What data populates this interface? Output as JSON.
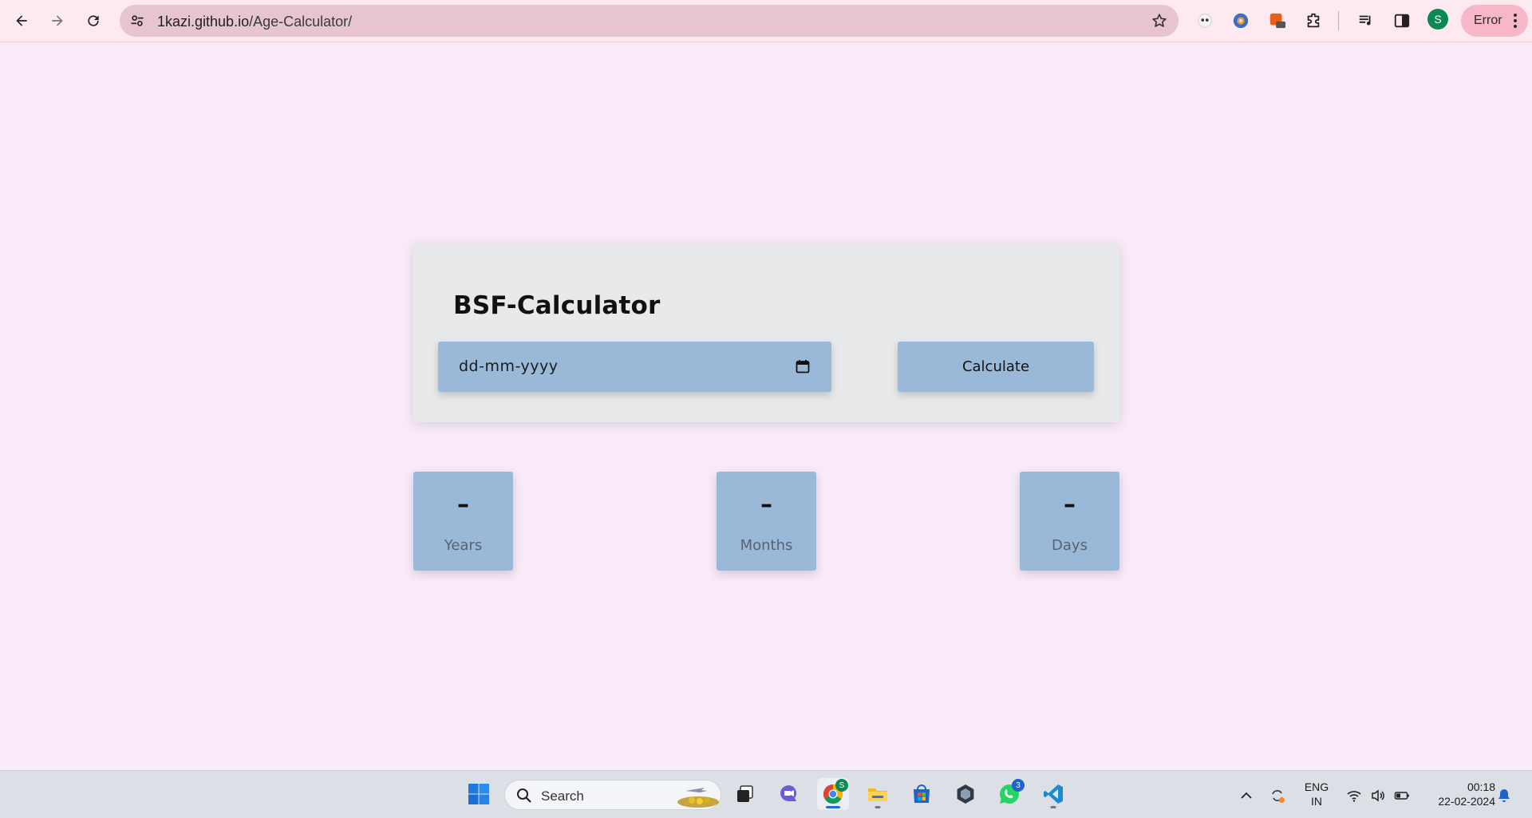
{
  "browser": {
    "url_host": "1kazi.github.io",
    "url_path": "/Age-Calculator/",
    "profile_initial": "S",
    "error_label": "Error",
    "extensions": [
      "panda-extension-icon",
      "ublock-icon",
      "off-extension-icon",
      "puzzle-extensions-icon"
    ],
    "ext_badge": "off"
  },
  "calculator": {
    "title": "BSF-Calculator",
    "date_placeholder": "dd-mm-yyyy",
    "calculate_label": "Calculate"
  },
  "results": [
    {
      "value": "–",
      "label": "Years"
    },
    {
      "value": "–",
      "label": "Months"
    },
    {
      "value": "–",
      "label": "Days"
    }
  ],
  "taskbar": {
    "search_label": "Search",
    "chrome_badge": "S",
    "whatsapp_badge": "3",
    "language_line1": "ENG",
    "language_line2": "IN",
    "time": "00:18",
    "date": "22-02-2024"
  },
  "colors": {
    "page_bg": "#f9eaf8",
    "card_bg": "#e8e9eb",
    "accent": "#9ab9d8",
    "chrome_bg": "#fde9f0"
  }
}
